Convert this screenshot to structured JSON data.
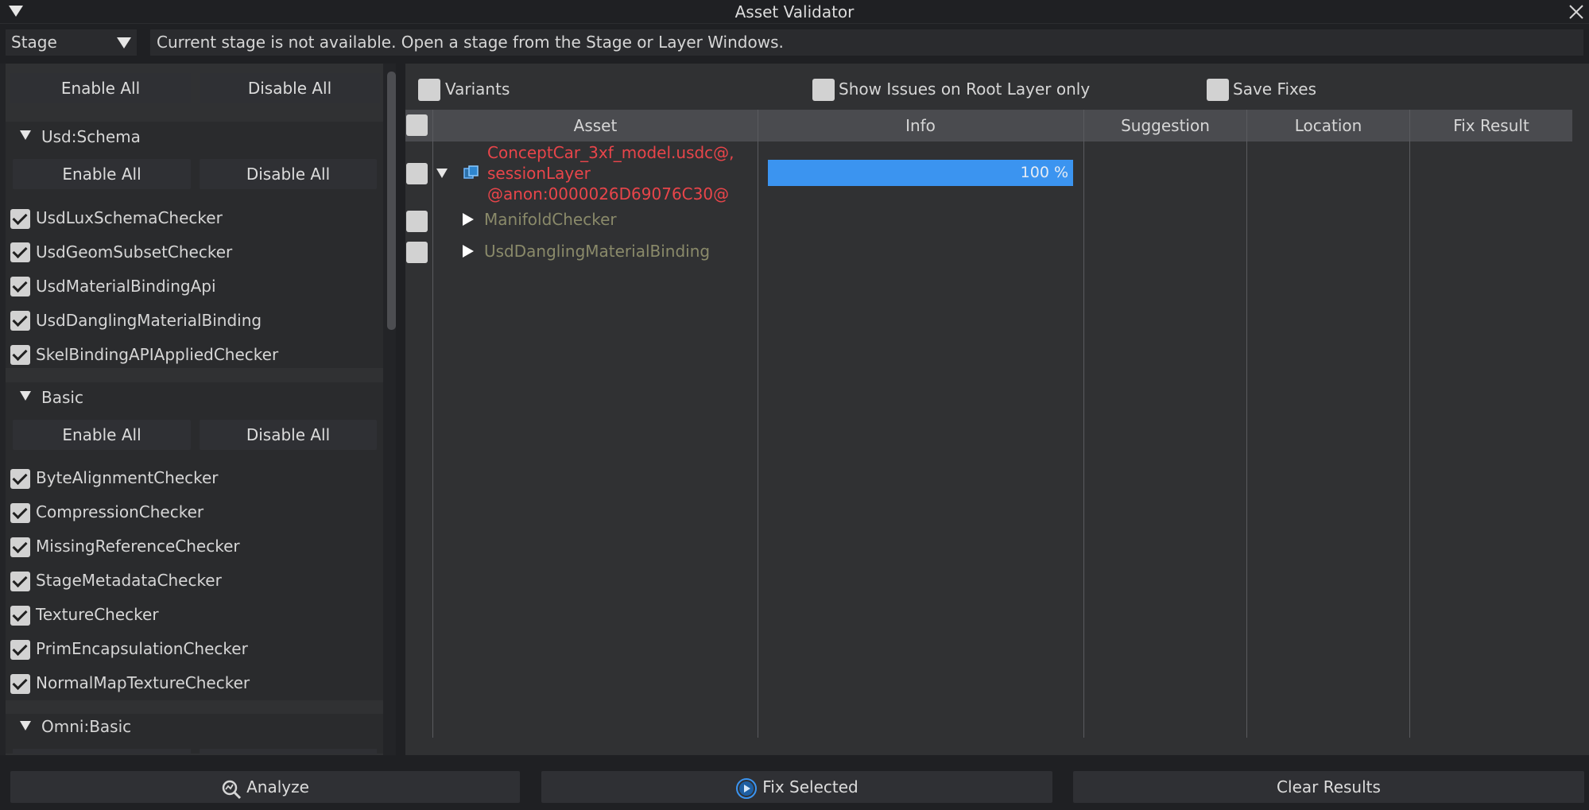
{
  "window": {
    "title": "Asset Validator"
  },
  "toolbar": {
    "mode_select": "Stage",
    "status_message": "Current stage is not available. Open a stage from the Stage or Layer Windows."
  },
  "left_panel": {
    "enable_all": "Enable All",
    "disable_all": "Disable All",
    "groups": [
      {
        "name": "Usd:Schema",
        "enable_all": "Enable All",
        "disable_all": "Disable All",
        "checkers": [
          "UsdLuxSchemaChecker",
          "UsdGeomSubsetChecker",
          "UsdMaterialBindingApi",
          "UsdDanglingMaterialBinding",
          "SkelBindingAPIAppliedChecker"
        ]
      },
      {
        "name": "Basic",
        "enable_all": "Enable All",
        "disable_all": "Disable All",
        "checkers": [
          "ByteAlignmentChecker",
          "CompressionChecker",
          "MissingReferenceChecker",
          "StageMetadataChecker",
          "TextureChecker",
          "PrimEncapsulationChecker",
          "NormalMapTextureChecker"
        ]
      },
      {
        "name": "Omni:Basic"
      }
    ]
  },
  "options": {
    "variants": "Variants",
    "root_layer_only": "Show Issues on Root Layer only",
    "save_fixes": "Save Fixes"
  },
  "table": {
    "columns": [
      "Asset",
      "Info",
      "Suggestion",
      "Location",
      "Fix Result"
    ],
    "root_row": {
      "asset_lines": [
        "ConceptCar_3xf_model.usdc@,",
        "sessionLayer",
        "@anon:0000026D69076C30@"
      ],
      "progress_text": "100 %",
      "progress": 1.0
    },
    "children": [
      "ManifoldChecker",
      "UsdDanglingMaterialBinding"
    ]
  },
  "footer": {
    "analyze": "Analyze",
    "fix_selected": "Fix Selected",
    "clear_results": "Clear Results"
  },
  "colors": {
    "error_text": "#e8454a",
    "checker_text": "#8a8a6a",
    "progress_fill": "#3b94f0"
  }
}
